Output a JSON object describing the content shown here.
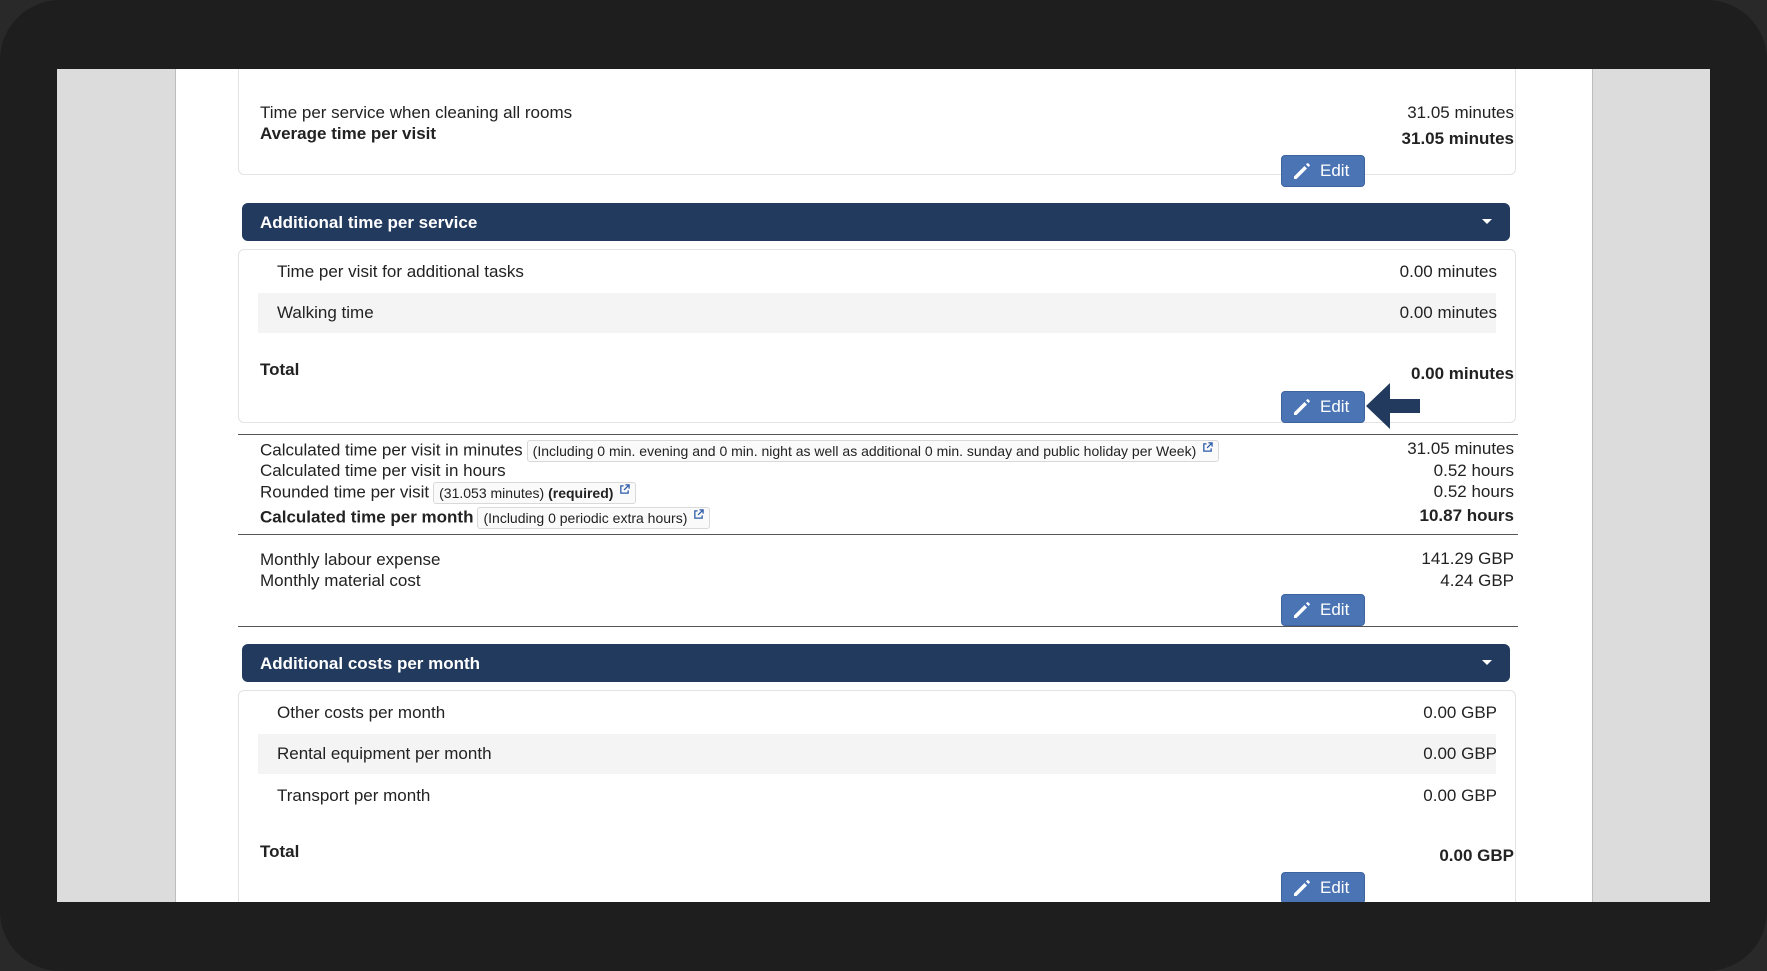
{
  "top_card": {
    "row1_label": "Time per service when cleaning all rooms",
    "row1_value": "31.05 minutes",
    "row2_label": "Average time per visit",
    "row2_value": "31.05 minutes",
    "edit_label": "Edit"
  },
  "additional_time": {
    "title": "Additional time per service",
    "rows": [
      {
        "label": "Time per visit for additional tasks",
        "value": "0.00 minutes"
      },
      {
        "label": "Walking time",
        "value": "0.00 minutes"
      }
    ],
    "total_label": "Total",
    "total_value": "0.00 minutes",
    "edit_label": "Edit"
  },
  "calculated": {
    "rows": [
      {
        "label": "Calculated time per visit in minutes",
        "tag": "(Including 0 min. evening and 0 min. night as well as additional 0 min. sunday and public holiday per Week)",
        "value": "31.05 minutes"
      },
      {
        "label": "Calculated time per visit in hours",
        "value": "0.52 hours"
      },
      {
        "label": "Rounded time per visit",
        "tag": "(31.053 minutes)",
        "tag_bold": "(required)",
        "value": "0.52 hours"
      },
      {
        "label": "Calculated time per month",
        "tag": "(Including 0 periodic extra hours)",
        "value": "10.87 hours"
      }
    ]
  },
  "monthly": {
    "rows": [
      {
        "label": "Monthly labour expense",
        "value": "141.29 GBP"
      },
      {
        "label": "Monthly material cost",
        "value": "4.24 GBP"
      }
    ],
    "edit_label": "Edit"
  },
  "additional_costs": {
    "title": "Additional costs per month",
    "rows": [
      {
        "label": "Other costs per month",
        "value": "0.00 GBP"
      },
      {
        "label": "Rental equipment per month",
        "value": "0.00 GBP"
      },
      {
        "label": "Transport per month",
        "value": "0.00 GBP"
      }
    ],
    "total_label": "Total",
    "total_value": "0.00 GBP",
    "edit_label": "Edit"
  },
  "colors": {
    "header": "#223a5e",
    "button": "#4a74b4",
    "arrow": "#223a5e"
  }
}
